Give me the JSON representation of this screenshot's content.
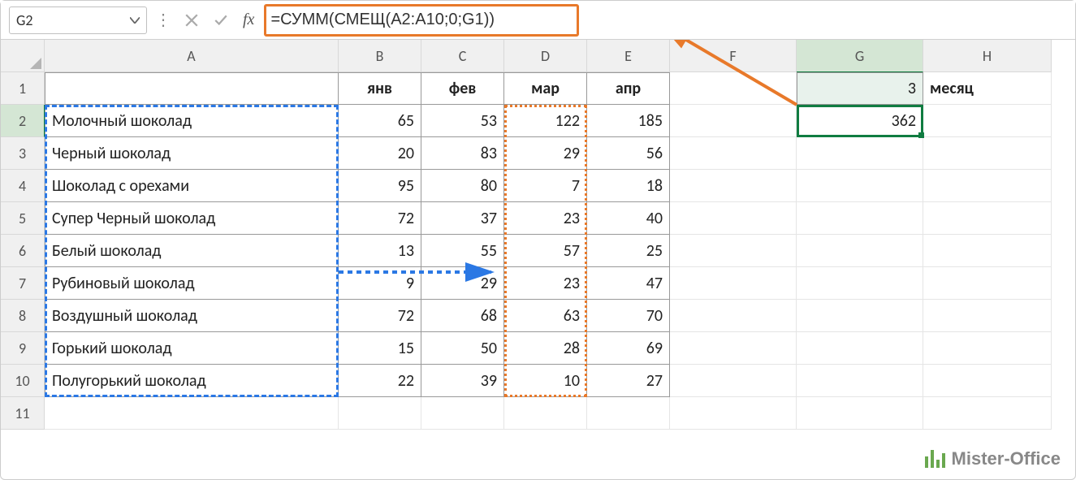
{
  "formula_bar": {
    "cell_ref": "G2",
    "formula": "=СУММ(СМЕЩ(A2:A10;0;G1))"
  },
  "columns": [
    "A",
    "B",
    "C",
    "D",
    "E",
    "F",
    "G",
    "H"
  ],
  "months": {
    "B": "янв",
    "C": "фев",
    "D": "мар",
    "E": "апр"
  },
  "g1_value": "3",
  "h1_label": "месяц",
  "g2_value": "362",
  "rows": [
    {
      "name": "Молочный шоколад",
      "b": "65",
      "c": "53",
      "d": "122",
      "e": "185"
    },
    {
      "name": "Черный шоколад",
      "b": "20",
      "c": "83",
      "d": "29",
      "e": "56"
    },
    {
      "name": "Шоколад с орехами",
      "b": "95",
      "c": "80",
      "d": "7",
      "e": "18"
    },
    {
      "name": "Супер Черный шоколад",
      "b": "72",
      "c": "37",
      "d": "23",
      "e": "40"
    },
    {
      "name": "Белый шоколад",
      "b": "13",
      "c": "55",
      "d": "57",
      "e": "25"
    },
    {
      "name": "Рубиновый шоколад",
      "b": "9",
      "c": "29",
      "d": "23",
      "e": "47"
    },
    {
      "name": "Воздушный шоколад",
      "b": "72",
      "c": "68",
      "d": "63",
      "e": "70"
    },
    {
      "name": "Горький шоколад",
      "b": "15",
      "c": "50",
      "d": "28",
      "e": "69"
    },
    {
      "name": "Полугорький шоколад",
      "b": "22",
      "c": "39",
      "d": "10",
      "e": "27"
    }
  ],
  "watermark": "Mister-Office"
}
